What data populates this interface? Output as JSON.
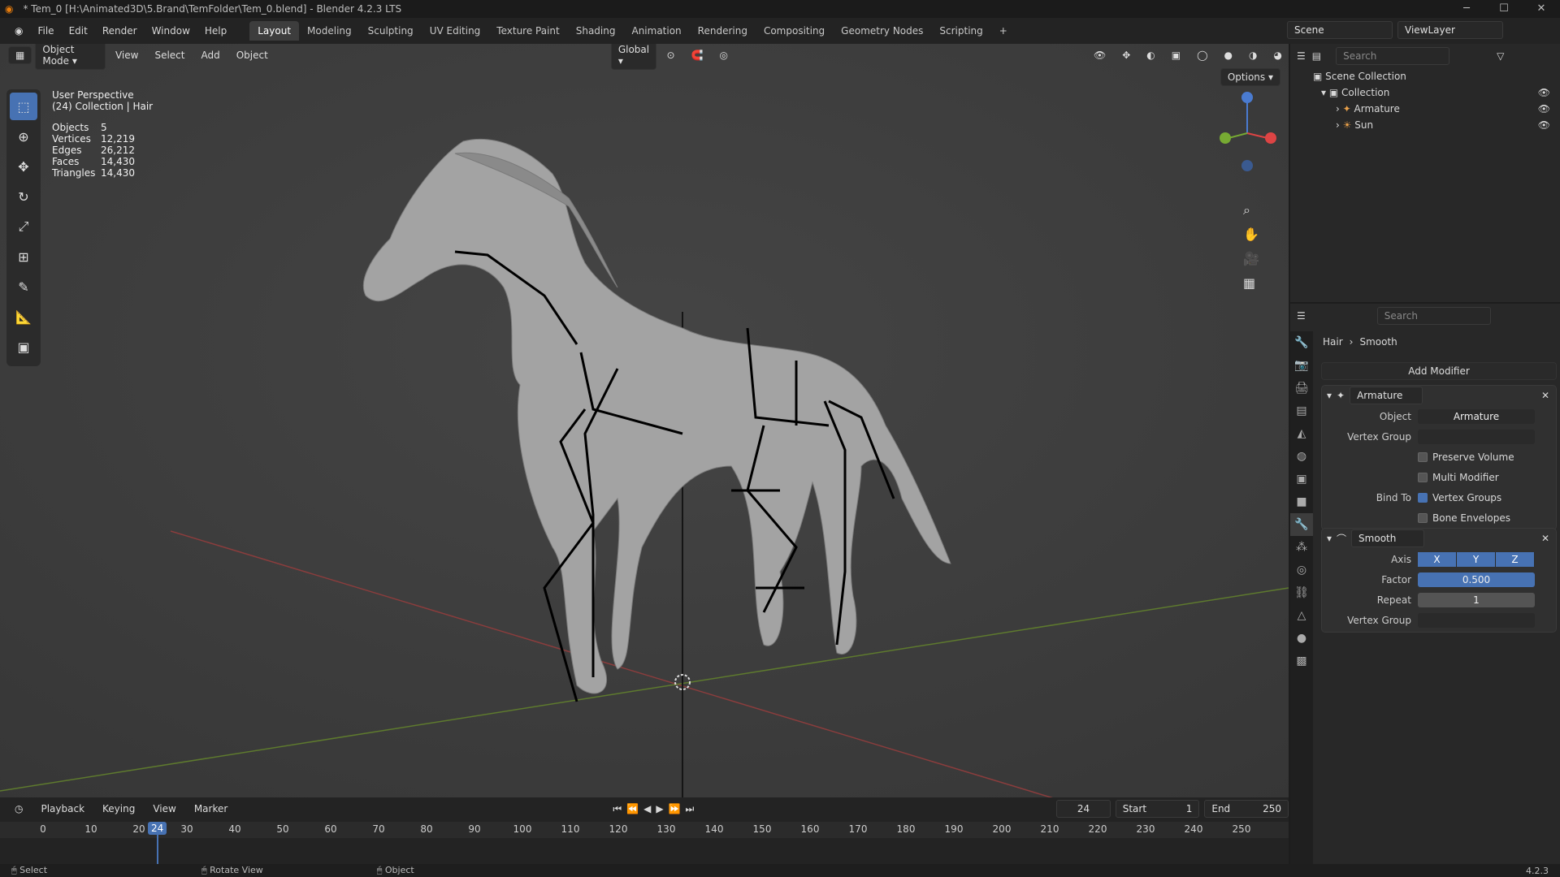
{
  "title": "* Tem_0 [H:\\Animated3D\\5.Brand\\TemFolder\\Tem_0.blend] - Blender 4.2.3 LTS",
  "menu": [
    "File",
    "Edit",
    "Render",
    "Window",
    "Help"
  ],
  "workspaces": [
    "Layout",
    "Modeling",
    "Sculpting",
    "UV Editing",
    "Texture Paint",
    "Shading",
    "Animation",
    "Rendering",
    "Compositing",
    "Geometry Nodes",
    "Scripting"
  ],
  "scene": {
    "name": "Scene",
    "viewlayer": "ViewLayer"
  },
  "viewport": {
    "mode": "Object Mode",
    "view": "View",
    "select": "Select",
    "add": "Add",
    "object": "Object",
    "transform": "Global",
    "options": "Options",
    "perspective": "User Perspective",
    "collection": "(24) Collection | Hair",
    "stats": [
      {
        "k": "Objects",
        "v": "5"
      },
      {
        "k": "Vertices",
        "v": "12,219"
      },
      {
        "k": "Edges",
        "v": "26,212"
      },
      {
        "k": "Faces",
        "v": "14,430"
      },
      {
        "k": "Triangles",
        "v": "14,430"
      }
    ]
  },
  "outliner": {
    "search": "Search",
    "root": "Scene Collection",
    "collection": "Collection",
    "items": [
      "Armature",
      "Sun"
    ]
  },
  "props": {
    "search": "Search",
    "breadcrumb": [
      "Hair",
      "Smooth"
    ],
    "add_modifier": "Add Modifier",
    "armature": {
      "name": "Armature",
      "object_label": "Object",
      "object": "Armature",
      "vg_label": "Vertex Group",
      "preserve": "Preserve Volume",
      "multi": "Multi Modifier",
      "bind_label": "Bind To",
      "bind_vg": "Vertex Groups",
      "bind_env": "Bone Envelopes"
    },
    "smooth": {
      "name": "Smooth",
      "axis_label": "Axis",
      "axes": [
        "X",
        "Y",
        "Z"
      ],
      "factor_label": "Factor",
      "factor": "0.500",
      "repeat_label": "Repeat",
      "repeat": "1",
      "vg_label": "Vertex Group"
    }
  },
  "timeline": {
    "playback": "Playback",
    "keying": "Keying",
    "view": "View",
    "marker": "Marker",
    "frame": "24",
    "start_label": "Start",
    "start": "1",
    "end_label": "End",
    "end": "250",
    "ticks": [
      "0",
      "10",
      "20",
      "30",
      "40",
      "50",
      "60",
      "70",
      "80",
      "90",
      "100",
      "110",
      "120",
      "130",
      "140",
      "150",
      "160",
      "170",
      "180",
      "190",
      "200",
      "210",
      "220",
      "230",
      "240",
      "250"
    ]
  },
  "status": {
    "select": "Select",
    "rotate": "Rotate View",
    "object": "Object",
    "version": "4.2.3"
  }
}
